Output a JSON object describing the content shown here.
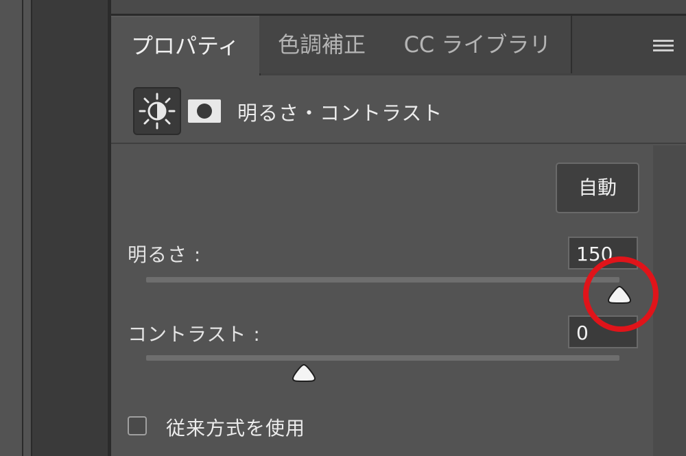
{
  "tabs": [
    {
      "label": "プロパティ",
      "active": true
    },
    {
      "label": "色調補正",
      "active": false
    },
    {
      "label": "CC ライブラリ",
      "active": false
    }
  ],
  "panel": {
    "title": "明るさ・コントラスト",
    "adjustment_icon": "brightness-contrast-icon",
    "mask_icon": "layer-mask-icon"
  },
  "auto_button": "自動",
  "brightness": {
    "label": "明るさ :",
    "value": "150",
    "min": -150,
    "max": 150,
    "level": 150
  },
  "contrast": {
    "label": "コントラスト :",
    "value": "0",
    "min": -50,
    "max": 100,
    "level": 0
  },
  "legacy": {
    "label": "従来方式を使用",
    "checked": false
  },
  "colors": {
    "highlight": "#e0141a",
    "panel_bg": "#535353"
  }
}
